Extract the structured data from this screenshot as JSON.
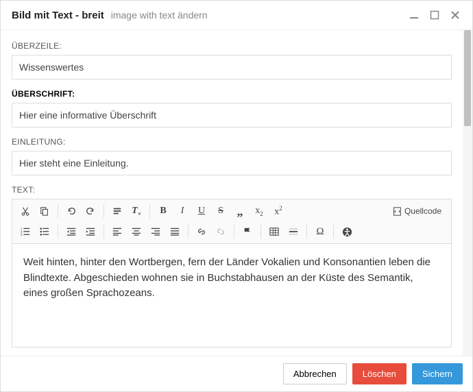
{
  "header": {
    "title": "Bild mit Text - breit",
    "subtitle": "image with text ändern"
  },
  "fields": {
    "overline_label": "ÜBERZEILE:",
    "overline_value": "Wissenswertes",
    "headline_label": "ÜBERSCHRIFT:",
    "headline_value": "Hier eine informative Überschrift",
    "intro_label": "EINLEITUNG:",
    "intro_value": "Hier steht eine Einleitung.",
    "text_label": "TEXT:"
  },
  "editor": {
    "source_label": "Quellcode",
    "content": "Weit hinten, hinter den Wortbergen, fern der Länder Vokalien und Konsonantien leben die Blindtexte. Abgeschieden wohnen sie in Buchstabhausen an der Küste des Semantik, eines großen Sprachozeans."
  },
  "footer": {
    "cancel": "Abbrechen",
    "delete": "Löschen",
    "save": "Sichern"
  }
}
